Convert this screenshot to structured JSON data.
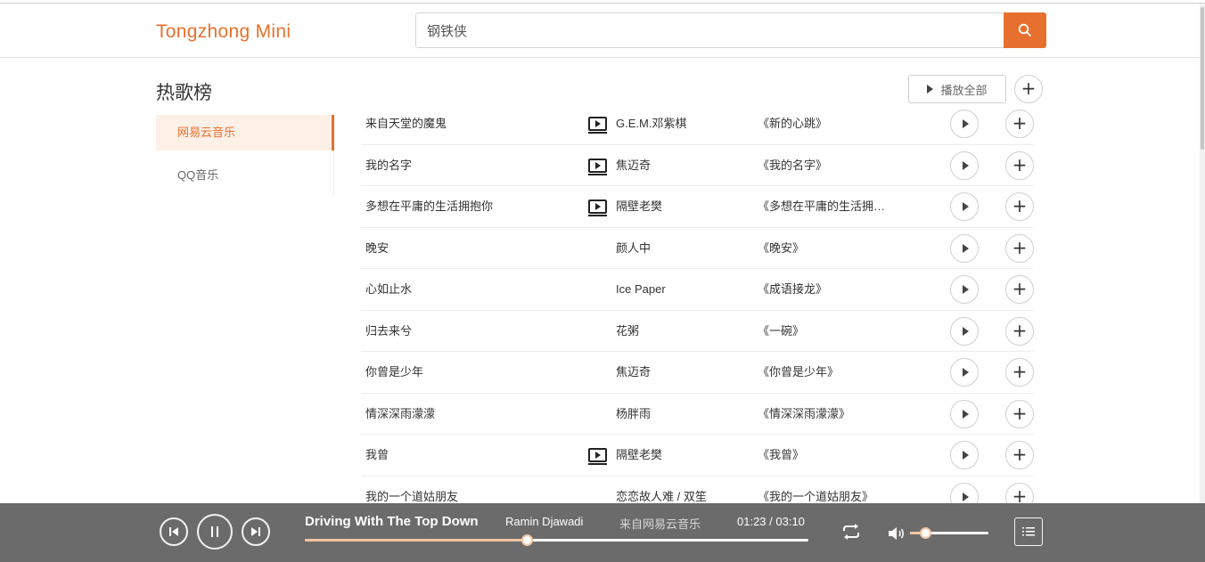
{
  "header": {
    "brand": "Tongzhong Mini",
    "search": {
      "value": "钢铁侠",
      "button_icon": "search-icon"
    }
  },
  "section_title": "热歌榜",
  "sidebar": {
    "items": [
      {
        "label": "网易云音乐",
        "active": true
      },
      {
        "label": "QQ音乐",
        "active": false
      }
    ]
  },
  "toolbar": {
    "play_all_label": "播放全部",
    "add_all_icon": "plus-icon"
  },
  "songs": [
    {
      "title": "来自天堂的魔鬼",
      "has_mv": true,
      "artist": "G.E.M.邓紫棋",
      "album": "《新的心跳》"
    },
    {
      "title": "我的名字",
      "has_mv": true,
      "artist": "焦迈奇",
      "album": "《我的名字》"
    },
    {
      "title": "多想在平庸的生活拥抱你",
      "has_mv": true,
      "artist": "隔壁老樊",
      "album": "《多想在平庸的生活拥抱你》"
    },
    {
      "title": "晚安",
      "has_mv": false,
      "artist": "颜人中",
      "album": "《晚安》"
    },
    {
      "title": "心如止水",
      "has_mv": false,
      "artist": "Ice Paper",
      "album": "《成语接龙》"
    },
    {
      "title": "归去来兮",
      "has_mv": false,
      "artist": "花粥",
      "album": "《一碗》"
    },
    {
      "title": "你曾是少年",
      "has_mv": false,
      "artist": "焦迈奇",
      "album": "《你曾是少年》"
    },
    {
      "title": "情深深雨濛濛",
      "has_mv": false,
      "artist": "杨胖雨",
      "album": "《情深深雨濛濛》"
    },
    {
      "title": "我曾",
      "has_mv": true,
      "artist": "隔壁老樊",
      "album": "《我曾》"
    },
    {
      "title": "我的一个道姑朋友",
      "has_mv": false,
      "artist": "恋恋故人难 / 双笙",
      "album": "《我的一个道姑朋友》"
    }
  ],
  "player": {
    "title": "Driving With The Top Down",
    "artist": "Ramin Djawadi",
    "source": "来自网易云音乐",
    "time": "01:23 / 03:10",
    "progress": 0.44,
    "volume": 0.19,
    "is_playing": true
  },
  "colors": {
    "accent": "#e8702e",
    "player_bg": "#6b6b6b",
    "progress_fill": "#f5c5a3",
    "active_bg": "#fdf0e7"
  }
}
